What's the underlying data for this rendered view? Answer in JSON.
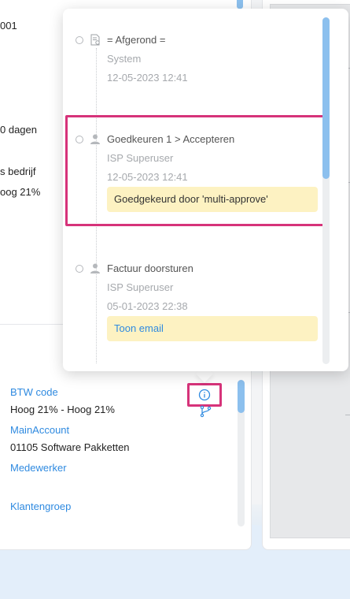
{
  "background_left": {
    "texts": [
      "001",
      "0 dagen",
      "s bedrijf",
      "oog 21%"
    ]
  },
  "details": {
    "btw_code_label": "BTW code",
    "btw_code_value": "Hoog 21% - Hoog 21%",
    "main_account_label": "MainAccount",
    "main_account_value": "01105 Software Pakketten",
    "employee_label": "Medewerker",
    "customer_group_label": "Klantengroep"
  },
  "timeline": {
    "items": [
      {
        "title": "= Afgerond =",
        "user": "System",
        "date": "12-05-2023 12:41",
        "icon": "document-icon"
      },
      {
        "title": "Goedkeuren 1 > Accepteren",
        "user": "ISP Superuser",
        "date": "12-05-2023 12:41",
        "note": "Goedgekeurd door 'multi-approve'",
        "icon": "user-icon"
      },
      {
        "title": "Factuur doorsturen",
        "user": "ISP Superuser",
        "date": "05-01-2023 22:38",
        "link": "Toon email",
        "icon": "user-icon"
      }
    ]
  },
  "colors": {
    "accent": "#2f8ae0",
    "highlight": "#d6337a",
    "note_bg": "#fdf2c2",
    "scroll_thumb": "#8cc0ee"
  }
}
